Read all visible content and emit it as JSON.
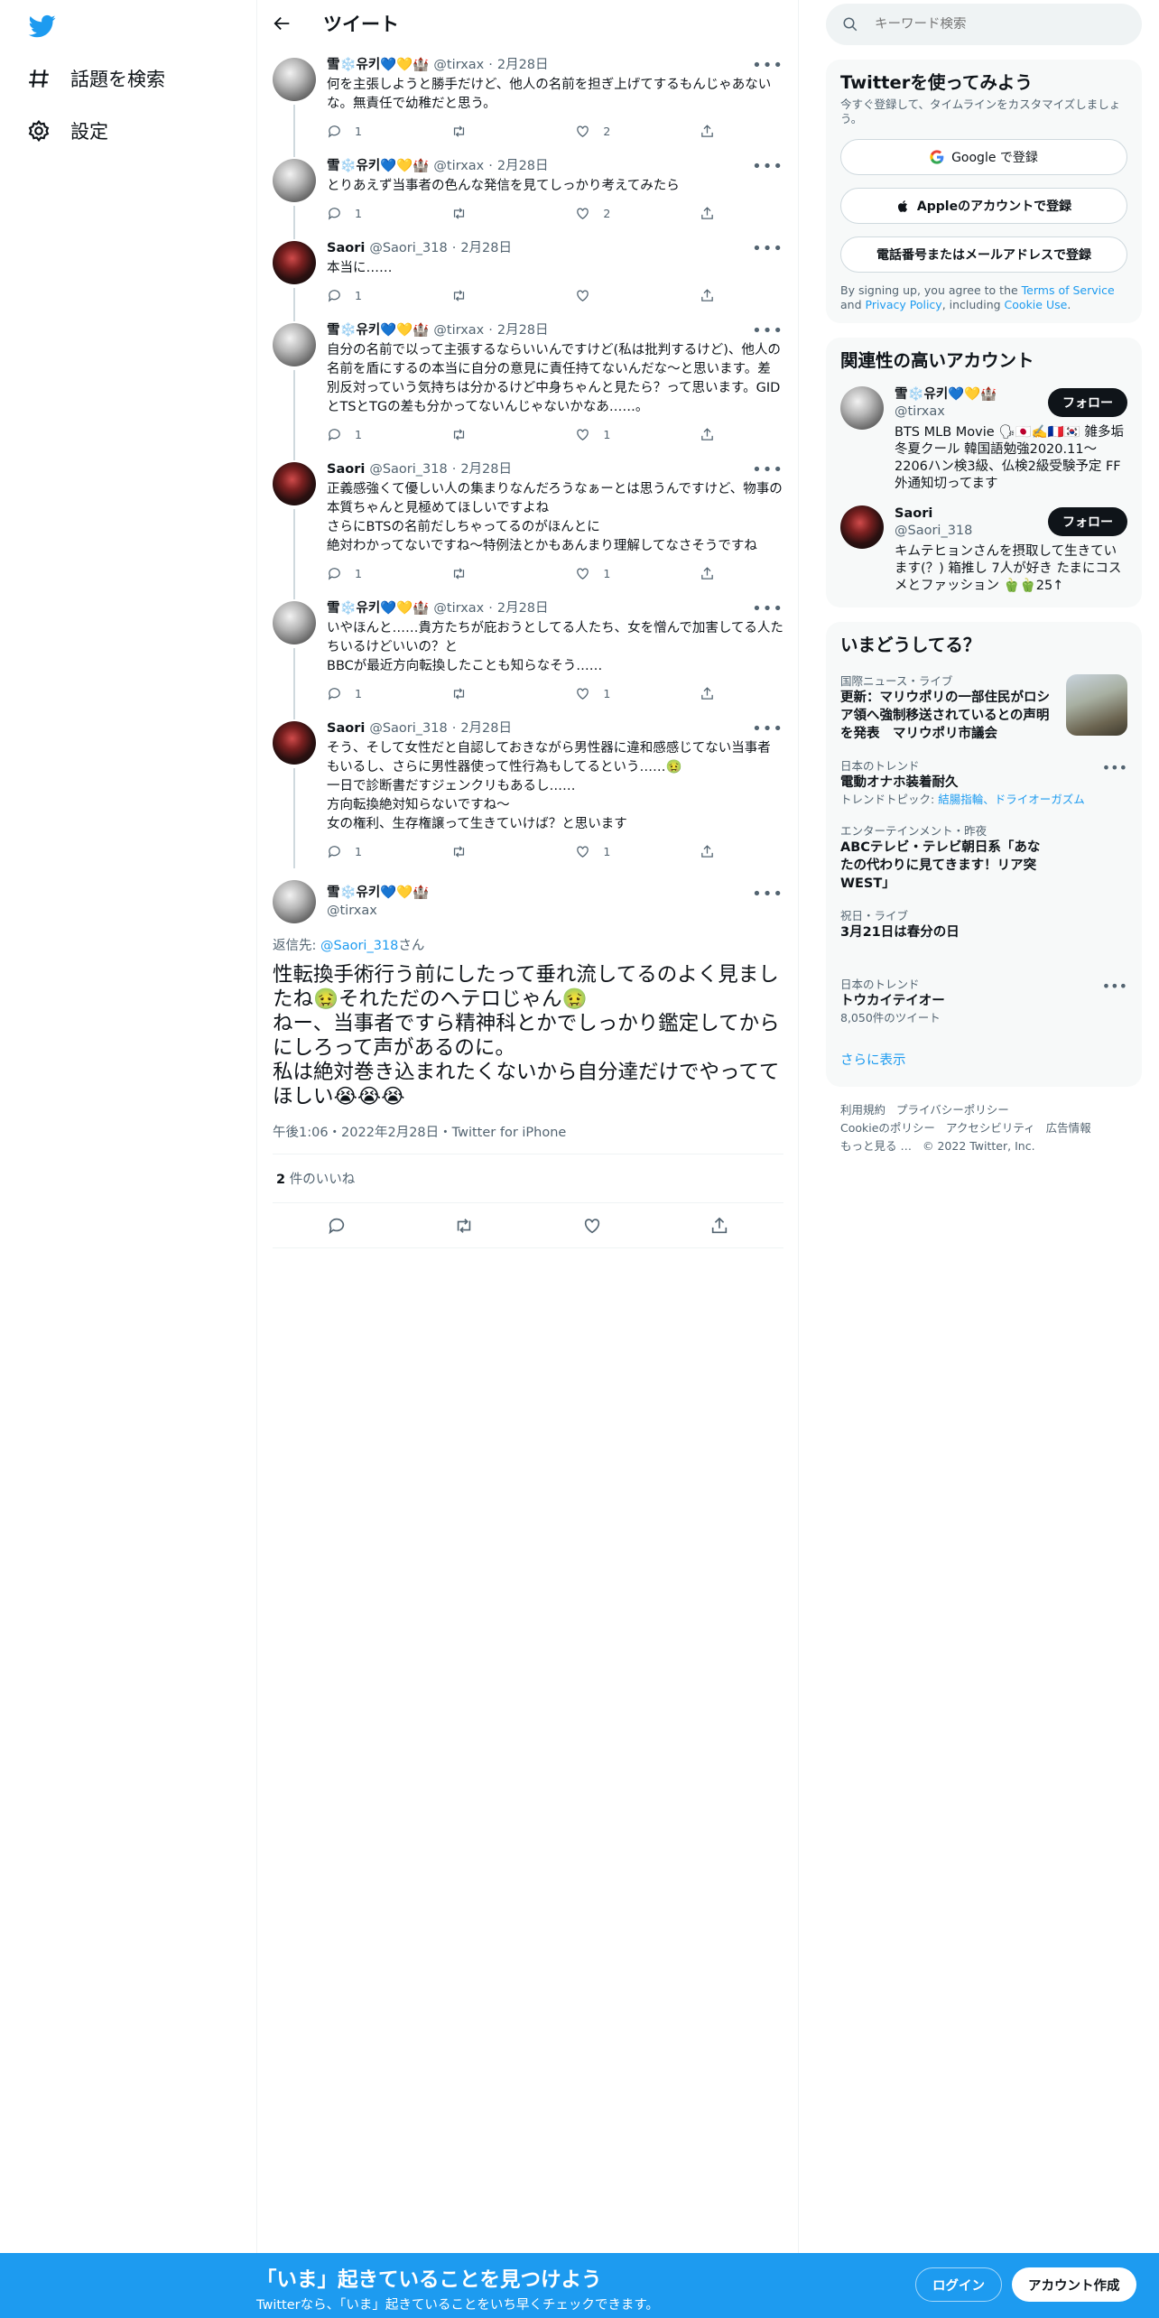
{
  "nav": {
    "explore_label": "話題を検索",
    "settings_label": "設定"
  },
  "header": {
    "title": "ツイート"
  },
  "tweets": [
    {
      "name": "雪❄️유키💙💛🏰",
      "handle": "@tirxax",
      "date": "2月28日",
      "text": "何を主張しようと勝手だけど、他人の名前を担ぎ上げてするもんじゃあないな。無責任で幼稚だと思う。",
      "replies": "1",
      "retweets": "",
      "likes": "2"
    },
    {
      "name": "雪❄️유키💙💛🏰",
      "handle": "@tirxax",
      "date": "2月28日",
      "text": "とりあえず当事者の色んな発信を見てしっかり考えてみたら",
      "replies": "1",
      "retweets": "",
      "likes": "2"
    },
    {
      "name": "Saori",
      "handle": "@Saori_318",
      "date": "2月28日",
      "text": "本当に……",
      "replies": "1",
      "retweets": "",
      "likes": ""
    },
    {
      "name": "雪❄️유키💙💛🏰",
      "handle": "@tirxax",
      "date": "2月28日",
      "text": "自分の名前で以って主張するならいいんですけど(私は批判するけど)、他人の名前を盾にするの本当に自分の意見に責任持てないんだな〜と思います。差別反対っていう気持ちは分かるけど中身ちゃんと見たら？って思います。GIDとTSとTGの差も分かってないんじゃないかなあ……。",
      "replies": "1",
      "retweets": "",
      "likes": "1"
    },
    {
      "name": "Saori",
      "handle": "@Saori_318",
      "date": "2月28日",
      "text": "正義感強くて優しい人の集まりなんだろうなぁーとは思うんですけど、物事の本質ちゃんと見極めてほしいですよね\nさらにBTSの名前だしちゃってるのがほんとに\n絶対わかってないですね〜特例法とかもあんまり理解してなさそうですね",
      "replies": "1",
      "retweets": "",
      "likes": "1"
    },
    {
      "name": "雪❄️유키💙💛🏰",
      "handle": "@tirxax",
      "date": "2月28日",
      "text": "いやほんと……貴方たちが庇おうとしてる人たち、女を憎んで加害してる人たちいるけどいいの？と\nBBCが最近方向転換したことも知らなそう……",
      "replies": "1",
      "retweets": "",
      "likes": "1"
    },
    {
      "name": "Saori",
      "handle": "@Saori_318",
      "date": "2月28日",
      "text": "そう、そして女性だと自認しておきながら男性器に違和感感じてない当事者もいるし、さらに男性器使って性行為もしてるという……🤢\n一日で診断書だすジェンクリもあるし……\n方向転換絶対知らないですね〜\n女の権利、生存権譲って生きていけば？と思います",
      "replies": "1",
      "retweets": "",
      "likes": "1"
    }
  ],
  "main_tweet": {
    "name": "雪❄️유키💙💛🏰",
    "handle": "@tirxax",
    "reply_prefix": "返信先: ",
    "reply_to": "@Saori_318",
    "reply_suffix": "さん",
    "text": "性転換手術行う前にしたって垂れ流してるのよく見ましたね🤢それただのヘテロじゃん🤢\nねー、当事者ですら精神科とかでしっかり鑑定してからにしろって声があるのに。\n私は絶対巻き込まれたくないから自分達だけでやっててほしい😭😭😭",
    "meta": "午後1:06・2022年2月28日・Twitter for iPhone",
    "likes_count": "2",
    "likes_label": " 件のいいね"
  },
  "search": {
    "placeholder": "キーワード検索"
  },
  "signup": {
    "title": "Twitterを使ってみよう",
    "subtitle": "今すぐ登録して、タイムラインをカスタマイズしましょう。",
    "google": "Google で登録",
    "apple": "Appleのアカウントで登録",
    "phone": "電話番号またはメールアドレスで登録",
    "terms_prefix": "By signing up, you agree to the ",
    "terms_link": "Terms of Service",
    "terms_and": " and ",
    "privacy_link": "Privacy Policy",
    "terms_including": ", including ",
    "cookie_link": "Cookie Use",
    "terms_end": "."
  },
  "related": {
    "title": "関連性の高いアカウント",
    "accounts": [
      {
        "name": "雪❄️유키💙💛🏰",
        "handle": "@tirxax",
        "bio": "BTS MLB Movie 🗣🇯🇵✍️🇫🇷🇰🇷 雑多垢 冬夏クール 韓国語勉強2020.11〜2206ハン検3級、仏検2級受験予定 FF外通知切ってます",
        "follow": "フォロー"
      },
      {
        "name": "Saori",
        "handle": "@Saori_318",
        "bio": "キムテヒョンさんを摂取して生きています(？) 箱推し 7人が好き たまにコスメとファッション 🫑🫑25↑",
        "follow": "フォロー"
      }
    ]
  },
  "trends": {
    "title": "いまどうしてる？",
    "items": [
      {
        "meta": "国際ニュース・ライブ",
        "name": "更新：マリウポリの一部住民がロシア領へ強制移送されているとの声明を発表　マリウポリ市議会",
        "sub": ""
      },
      {
        "meta": "日本のトレンド",
        "name": "電動オナホ装着耐久",
        "sub_prefix": "トレンドトピック: ",
        "sub_links": "結腸指輪、ドライオーガズム"
      },
      {
        "meta": "エンターテインメント・昨夜",
        "name": "ABCテレビ・テレビ朝日系「あなたの代わりに見てきます！リア突WEST」",
        "sub": ""
      },
      {
        "meta": "祝日・ライブ",
        "name": "3月21日は春分の日",
        "sub": ""
      },
      {
        "meta": "日本のトレンド",
        "name": "トウカイテイオー",
        "sub": "8,050件のツイート"
      }
    ],
    "show_more": "さらに表示"
  },
  "footer": {
    "links": [
      "利用規約",
      "プライバシーポリシー",
      "Cookieのポリシー",
      "アクセシビリティ",
      "広告情報",
      "もっと見る …",
      "© 2022 Twitter, Inc."
    ]
  },
  "bottombar": {
    "title": "「いま」起きていることを見つけよう",
    "subtitle": "Twitterなら、「いま」起きていることをいち早くチェックできます。",
    "login": "ログイン",
    "signup": "アカウント作成"
  },
  "colors": {
    "accent": "#1d9bf0",
    "text": "#0f1419",
    "muted": "#536471"
  }
}
